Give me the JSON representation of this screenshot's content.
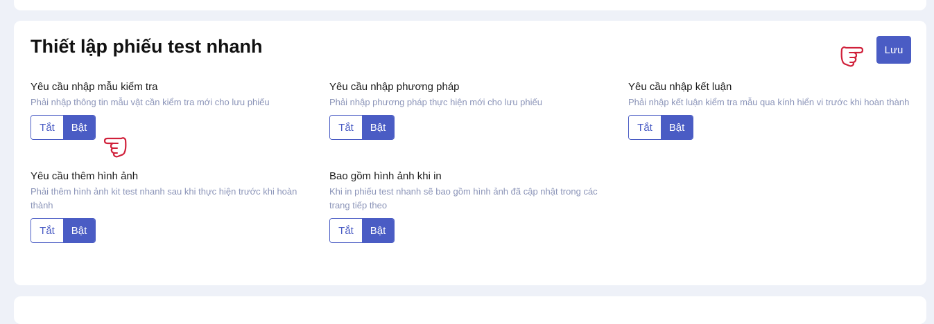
{
  "title": "Thiết lập phiếu test nhanh",
  "save_label": "Lưu",
  "colors": {
    "accent": "#4a5cc4",
    "hand": "#d0203a",
    "muted": "#8b94b8"
  },
  "settings": [
    {
      "label": "Yêu cầu nhập mẫu kiểm tra",
      "desc": "Phải nhập thông tin mẫu vật cần kiểm tra mới cho lưu phiếu",
      "off": "Tắt",
      "on": "Bật",
      "selected": "Bật"
    },
    {
      "label": "Yêu cầu nhập phương pháp",
      "desc": "Phải nhập phương pháp thực hiện mới cho lưu phiếu",
      "off": "Tắt",
      "on": "Bật",
      "selected": "Bật"
    },
    {
      "label": "Yêu cầu nhập kết luận",
      "desc": "Phải nhập kết luận kiểm tra mẫu qua kính hiển vi trước khi hoàn thành",
      "off": "Tắt",
      "on": "Bật",
      "selected": "Bật"
    },
    {
      "label": "Yêu cầu thêm hình ảnh",
      "desc": "Phải thêm hình ảnh kit test nhanh sau khi thực hiện trước khi hoàn thành",
      "off": "Tắt",
      "on": "Bật",
      "selected": "Bật"
    },
    {
      "label": "Bao gồm hình ảnh khi in",
      "desc": "Khi in phiếu test nhanh sẽ bao gồm hình ảnh đã cập nhật trong các trang tiếp theo",
      "off": "Tắt",
      "on": "Bật",
      "selected": "Bật"
    }
  ],
  "icons": {
    "pointer_right": "hand-pointing-right-icon",
    "pointer_left": "hand-pointing-left-icon"
  }
}
